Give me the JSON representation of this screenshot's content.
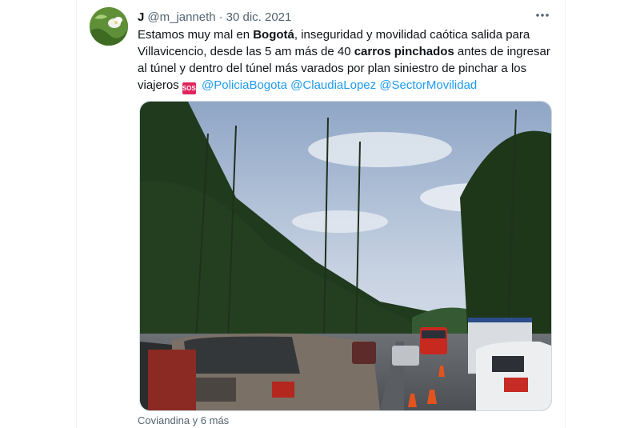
{
  "tweet": {
    "display_name": "J",
    "handle": "@m_janneth",
    "separator": "·",
    "date": "30 dic. 2021",
    "more_icon": "ellipsis-icon",
    "text_lines": [
      {
        "pre": "Estamos muy mal en ",
        "bold": "Bogotá",
        "post": ", inseguridad y movilidad caótica salida para"
      },
      {
        "pre": "Villavicencio, desde las 5 am más de 40 ",
        "bold": "carros pinchados",
        "post": " antes de ingresar"
      },
      {
        "pre": "al túnel y dentro del túnel más varados por plan siniestro de pinchar a los",
        "bold": "",
        "post": ""
      }
    ],
    "last_line_prefix": "viajeros ",
    "sos_emoji": "SOS",
    "mentions": [
      "@PoliciaBogota",
      "@ClaudiaLopez",
      "@SectorMovilidad"
    ],
    "liked_by": "Coviandina y 6 más"
  },
  "colors": {
    "link": "#1d9bf0",
    "text": "#0f1419",
    "secondary": "#536471",
    "sos": "#e0245e"
  }
}
